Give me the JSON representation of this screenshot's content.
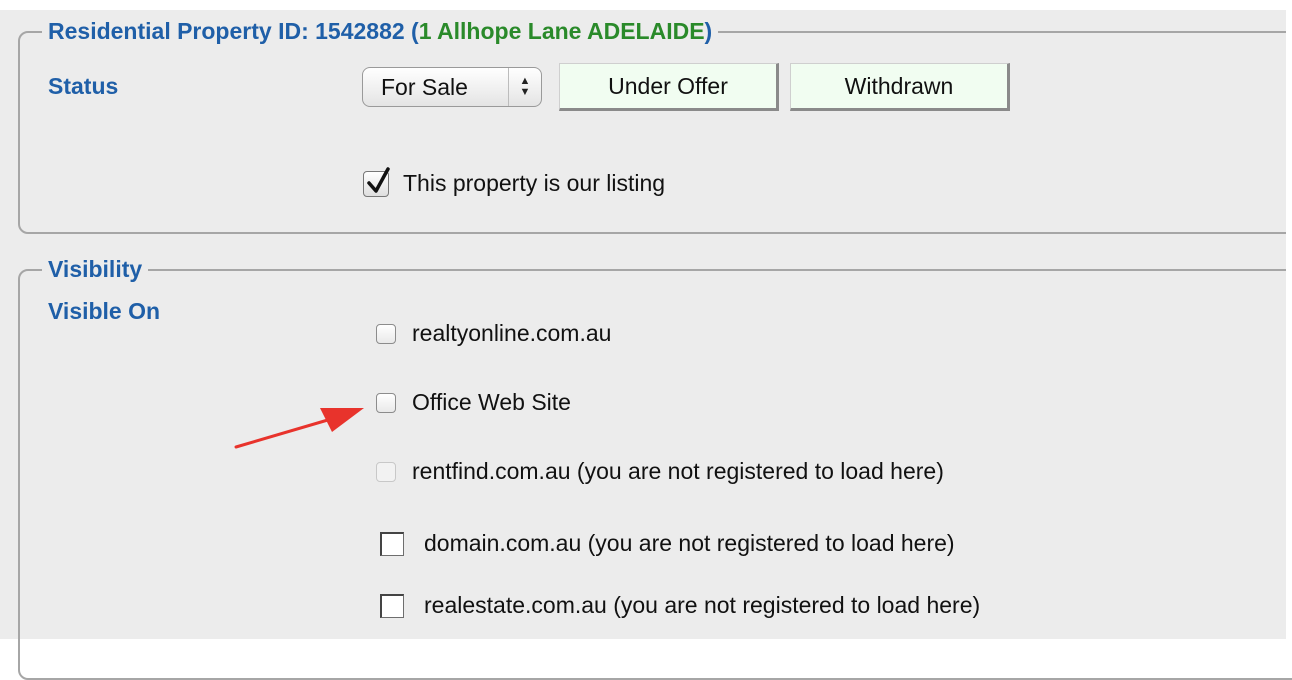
{
  "property_section": {
    "legend_prefix": "Residential Property ID: 1542882 (",
    "legend_address": "1 Allhope Lane ADELAIDE",
    "legend_suffix": ")",
    "status_label": "Status",
    "status_select": {
      "selected": "For Sale"
    },
    "buttons": {
      "under_offer": "Under Offer",
      "withdrawn": "Withdrawn"
    },
    "our_listing": {
      "label": "This property is our listing",
      "checked": true
    }
  },
  "visibility_section": {
    "legend": "Visibility",
    "visible_on_label": "Visible On",
    "sites": [
      {
        "label": "realtyonline.com.au",
        "checked": false,
        "enabled": true
      },
      {
        "label": "Office Web Site",
        "checked": false,
        "enabled": true
      },
      {
        "label": "rentfind.com.au (you are not registered to load here)",
        "checked": false,
        "enabled": false
      },
      {
        "label": "domain.com.au (you are not registered to load here)",
        "checked": false,
        "enabled": true
      },
      {
        "label": "realestate.com.au (you are not registered to load here)",
        "checked": false,
        "enabled": true
      }
    ]
  },
  "annotation": {
    "arrow_color": "#e8332c",
    "points_to": "Office Web Site"
  },
  "colors": {
    "section_title": "#1f5fa8",
    "address_green": "#2a8a2a",
    "button_bg": "#f1fdf1"
  }
}
